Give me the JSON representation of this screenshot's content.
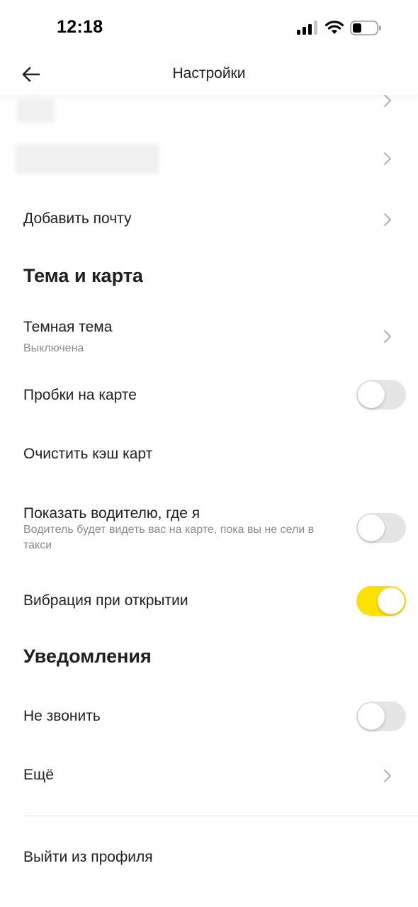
{
  "status_bar": {
    "time": "12:18"
  },
  "header": {
    "title": "Настройки"
  },
  "rows": {
    "add_email": "Добавить почту",
    "dark_theme": {
      "label": "Темная тема",
      "value": "Выключена"
    },
    "traffic": {
      "label": "Пробки на карте",
      "enabled": false
    },
    "clear_cache": "Очистить кэш карт",
    "show_driver": {
      "label": "Показать водителю, где я",
      "hint": "Водитель будет видеть вас на карте, пока вы не сели в такси",
      "enabled": false
    },
    "vibration": {
      "label": "Вибрация при открытии",
      "enabled": true
    },
    "do_not_call": {
      "label": "Не звонить",
      "enabled": false
    },
    "more": "Ещё",
    "logout": "Выйти из профиля"
  },
  "sections": {
    "theme_map": "Тема и карта",
    "notifications": "Уведомления"
  },
  "colors": {
    "toggle_on": "#fce000",
    "toggle_off": "#e5e5e5",
    "text": "#21201f",
    "secondary": "#8c8a87"
  },
  "icons": [
    "back-arrow-icon",
    "chevron-right-icon",
    "cellular-signal-icon",
    "wifi-icon",
    "battery-icon"
  ]
}
